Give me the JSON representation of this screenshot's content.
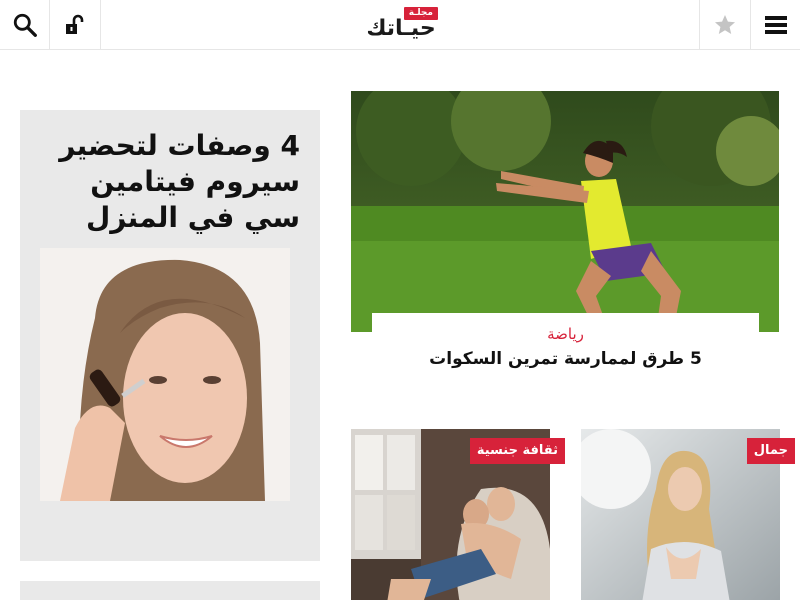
{
  "header": {
    "logo_badge": "مجلـة",
    "logo_text": "حيـاتك"
  },
  "left_card": {
    "title": "4 وصفات لتحضير سيروم فيتامين سي في المنزل"
  },
  "featured": {
    "category": "رياضة",
    "title": "5 طرق لممارسة تمرين السكوات"
  },
  "small_cards": [
    {
      "badge": "ثقافة جنسية"
    },
    {
      "badge": "جمال"
    }
  ],
  "colors": {
    "accent": "#d7223a",
    "text": "#111111",
    "panel": "#e9e9e9",
    "border": "#e6e6e6"
  }
}
